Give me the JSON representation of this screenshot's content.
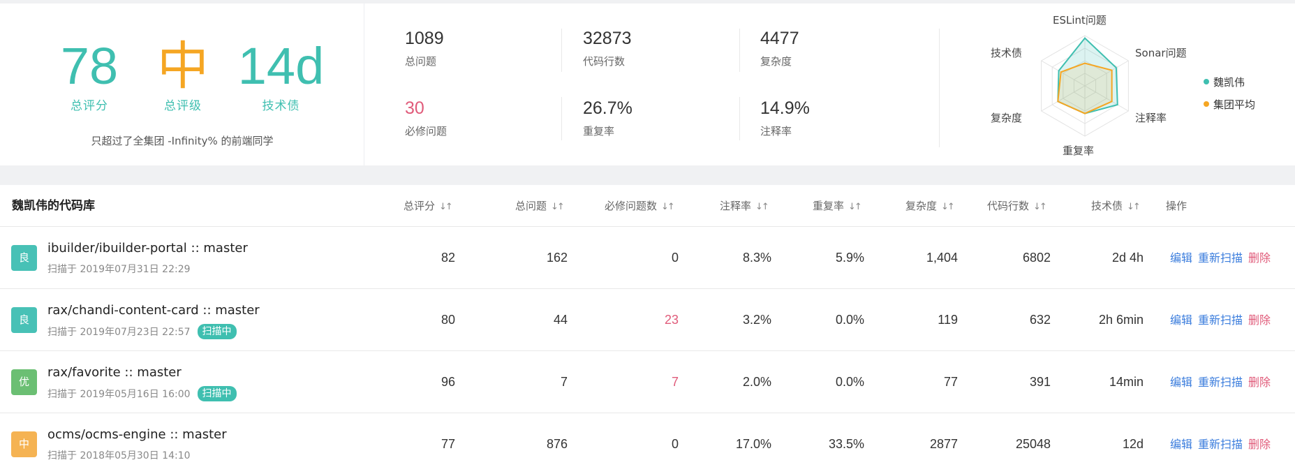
{
  "summary": {
    "total_score": {
      "value": "78",
      "label": "总评分"
    },
    "total_grade": {
      "value": "中",
      "label": "总评级"
    },
    "tech_debt": {
      "value": "14d",
      "label": "技术债"
    },
    "beat_text": "只超过了全集团 -Infinity% 的前端同学",
    "stats": [
      {
        "value": "1089",
        "label": "总问题",
        "highlight": false
      },
      {
        "value": "32873",
        "label": "代码行数",
        "highlight": false
      },
      {
        "value": "4477",
        "label": "复杂度",
        "highlight": false
      },
      {
        "value": "30",
        "label": "必修问题",
        "highlight": true
      },
      {
        "value": "26.7%",
        "label": "重复率",
        "highlight": false
      },
      {
        "value": "14.9%",
        "label": "注释率",
        "highlight": false
      }
    ]
  },
  "radar": {
    "axes": [
      "ESLint问题",
      "Sonar问题",
      "注释率",
      "重复率",
      "复杂度",
      "技术债"
    ],
    "legend": [
      {
        "name": "魏凯伟",
        "color": "#3fbfb0"
      },
      {
        "name": "集团平均",
        "color": "#f5a623"
      }
    ],
    "series": [
      {
        "name": "魏凯伟",
        "values": [
          0.95,
          0.72,
          0.75,
          0.55,
          0.62,
          0.6
        ]
      },
      {
        "name": "集团平均",
        "values": [
          0.45,
          0.62,
          0.62,
          0.55,
          0.62,
          0.55
        ]
      }
    ]
  },
  "table": {
    "title": "魏凯伟的代码库",
    "columns": [
      "总评分",
      "总问题",
      "必修问题数",
      "注释率",
      "重复率",
      "复杂度",
      "代码行数",
      "技术债",
      "操作"
    ],
    "sort_icon": "sort-icon",
    "actions": {
      "edit": "编辑",
      "rescan": "重新扫描",
      "delete": "删除"
    },
    "rows": [
      {
        "grade": "良",
        "grade_color": "#48c1b6",
        "name": "ibuilder/ibuilder-portal :: master",
        "scanned": "扫描于 2019年07月31日 22:29",
        "badge": "",
        "score": "82",
        "issues": "162",
        "required": "0",
        "required_highlight": false,
        "comment": "8.3%",
        "dup": "5.9%",
        "complexity": "1,404",
        "lines": "6802",
        "debt": "2d 4h"
      },
      {
        "grade": "良",
        "grade_color": "#48c1b6",
        "name": "rax/chandi-content-card :: master",
        "scanned": "扫描于 2019年07月23日 22:57",
        "badge": "扫描中",
        "score": "80",
        "issues": "44",
        "required": "23",
        "required_highlight": true,
        "comment": "3.2%",
        "dup": "0.0%",
        "complexity": "119",
        "lines": "632",
        "debt": "2h 6min"
      },
      {
        "grade": "优",
        "grade_color": "#6bbf73",
        "name": "rax/favorite :: master",
        "scanned": "扫描于 2019年05月16日 16:00",
        "badge": "扫描中",
        "score": "96",
        "issues": "7",
        "required": "7",
        "required_highlight": true,
        "comment": "2.0%",
        "dup": "0.0%",
        "complexity": "77",
        "lines": "391",
        "debt": "14min"
      },
      {
        "grade": "中",
        "grade_color": "#f5b353",
        "name": "ocms/ocms-engine :: master",
        "scanned": "扫描于 2018年05月30日 14:10",
        "badge": "",
        "score": "77",
        "issues": "876",
        "required": "0",
        "required_highlight": false,
        "comment": "17.0%",
        "dup": "33.5%",
        "complexity": "2877",
        "lines": "25048",
        "debt": "12d"
      }
    ]
  }
}
